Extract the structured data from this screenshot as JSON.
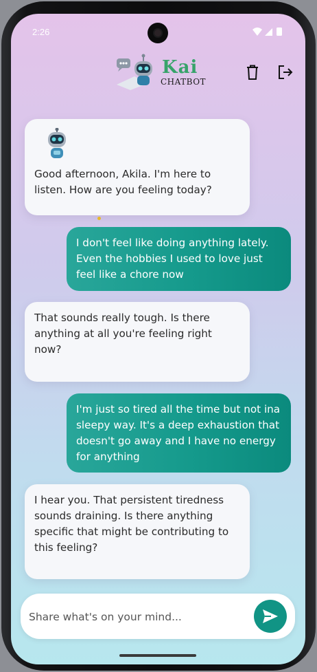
{
  "status_bar": {
    "time": "2:26",
    "icons": [
      "wifi-icon",
      "signal-icon",
      "battery-icon"
    ]
  },
  "header": {
    "logo_title": "Kai",
    "logo_subtitle": "CHATBOT",
    "logo_icon": "robot-chat-icon",
    "delete_icon": "trash-icon",
    "logout_icon": "logout-icon"
  },
  "messages": [
    {
      "sender": "bot",
      "text": "Good afternoon, Akila. I'm here to listen. How are you feeling today?"
    },
    {
      "sender": "user",
      "text": "I don't feel like doing anything lately. Even the hobbies I used to love just feel like a chore now"
    },
    {
      "sender": "bot",
      "text": "That sounds really tough.  Is there anything at all you're feeling right now?"
    },
    {
      "sender": "user",
      "text": "I'm just so tired all the time but not ina sleepy way. It's a deep exhaustion that doesn't go away and I have no energy for anything"
    },
    {
      "sender": "bot",
      "text": "I hear you.  That persistent tiredness sounds draining.  Is there anything specific that might be contributing to this feeling?"
    }
  ],
  "composer": {
    "placeholder": "Share what's on your mind...",
    "value": "",
    "send_icon": "send-icon"
  },
  "colors": {
    "accent": "#119485",
    "user_bubble": "#159a8c",
    "bot_bubble": "#f6f7fa",
    "logo_green": "#37a36a"
  }
}
